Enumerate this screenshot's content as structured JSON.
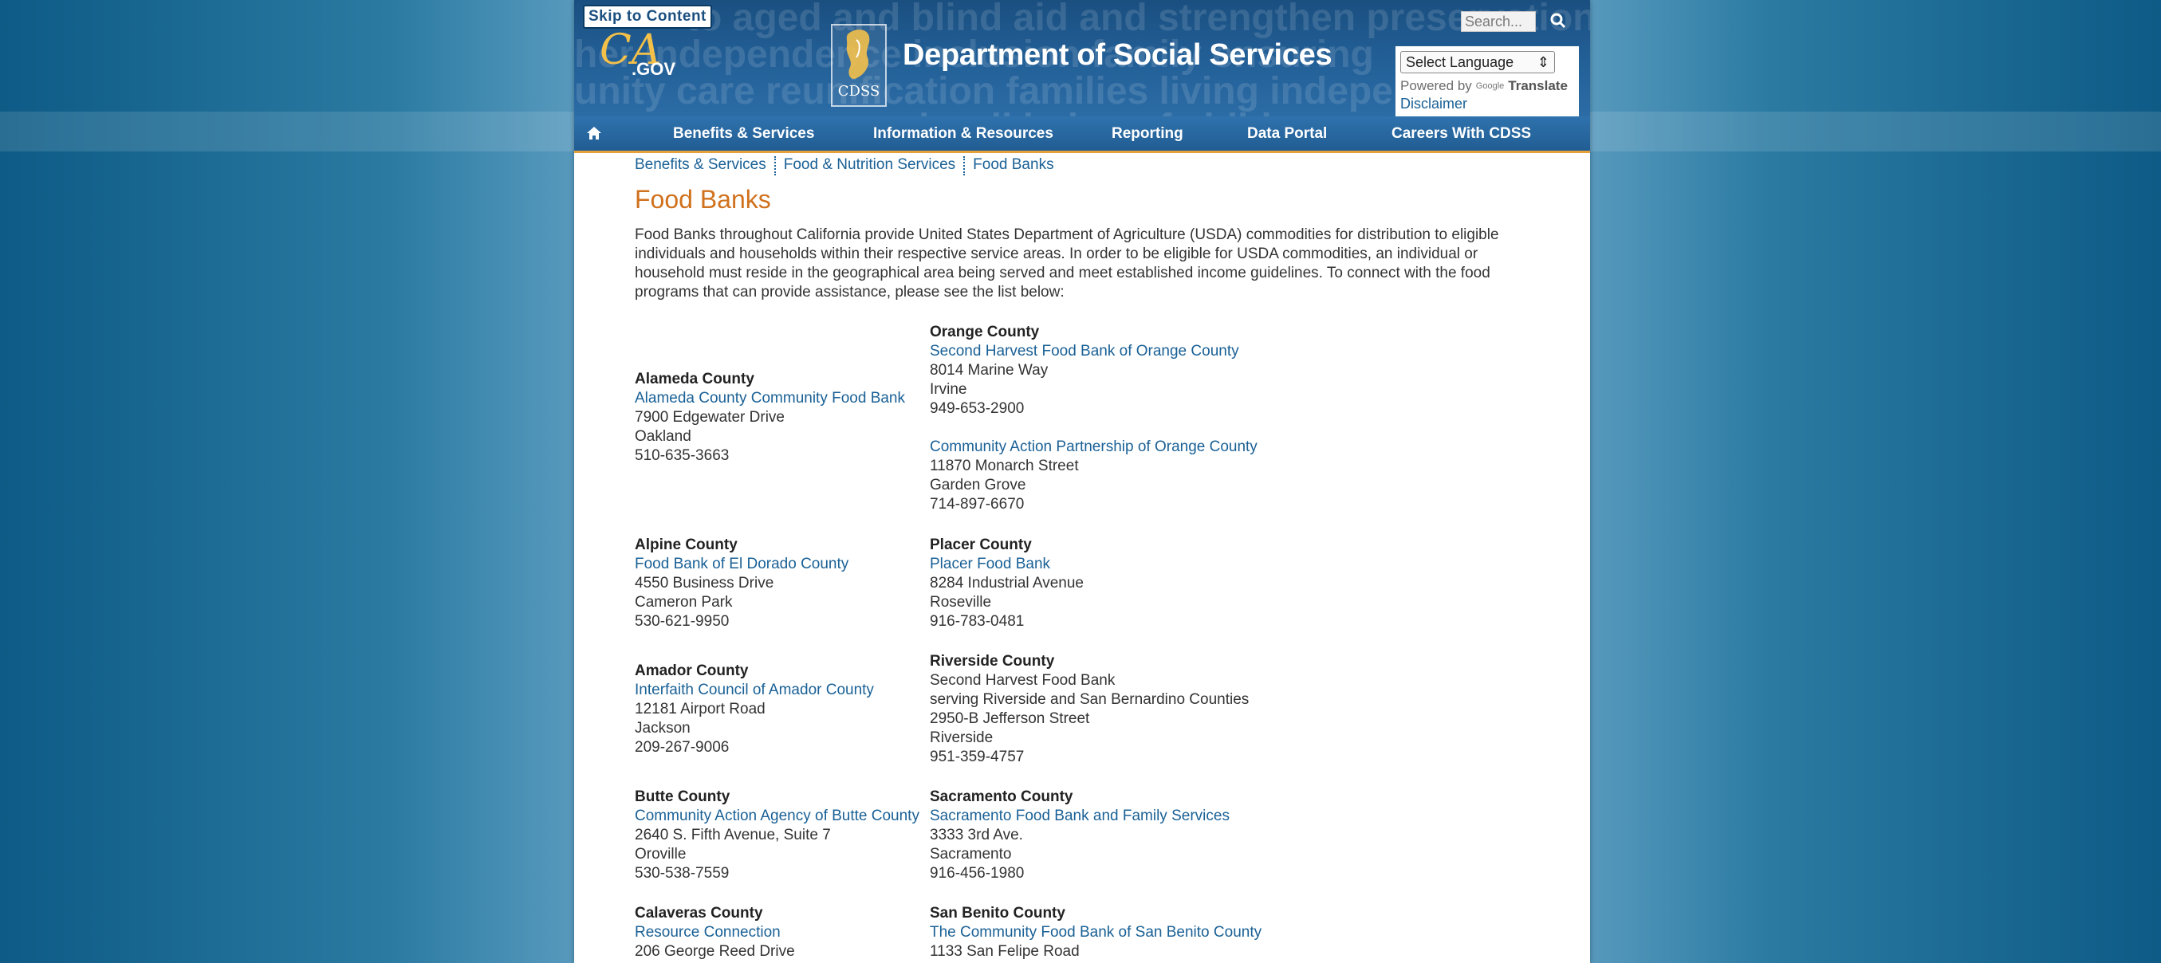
{
  "header": {
    "skip_link": "Skip to Content",
    "department_title": "Department of Social Services",
    "ca_logo_text": "CA.GOV",
    "cdss_logo_text": "CDSS",
    "search_placeholder": "Search...",
    "language_select": "Select Language",
    "powered_by": "Powered by",
    "google_text": "Google",
    "translate_text": "Translate",
    "disclaimer": "Disclaimer",
    "watermark_lines": [
      "to aged and blind aid and strengthen preservation",
      "her independence  inclusion  family  ensuring",
      "unity care reunification  families  living independently",
      "       and well being of children"
    ]
  },
  "nav": {
    "items": [
      "Benefits & Services",
      "Information & Resources",
      "Reporting",
      "Data Portal",
      "Careers With CDSS"
    ]
  },
  "breadcrumb": [
    "Benefits & Services",
    "Food & Nutrition Services",
    "Food Banks"
  ],
  "page_title": "Food Banks",
  "intro": "Food Banks throughout California provide United States Department of Agriculture (USDA) commodities for distribution to eligible individuals and households within their respective service areas. In order to be eligible for USDA commodities, an individual or household must reside in the geographical area being served and meet established income guidelines. To connect with the food programs that can provide assistance, please see the list below:",
  "left_column": [
    {
      "county": "Alameda County",
      "bank": "Alameda County Community Food Bank",
      "lines": [
        "7900 Edgewater Drive",
        "Oakland",
        "510-635-3663"
      ]
    },
    {
      "county": "Alpine County",
      "bank": "Food Bank of El Dorado County",
      "lines": [
        "4550 Business Drive",
        "Cameron Park",
        "530-621-9950"
      ]
    },
    {
      "county": "Amador County",
      "bank": "Interfaith Council of Amador County",
      "lines": [
        "12181 Airport Road",
        "Jackson",
        "209-267-9006"
      ]
    },
    {
      "county": "Butte County",
      "bank": "Community Action Agency of Butte County",
      "lines": [
        "2640 S. Fifth Avenue, Suite 7",
        "Oroville",
        "530-538-7559"
      ]
    },
    {
      "county": "Calaveras County",
      "bank": "Resource Connection",
      "lines": [
        "206 George Reed Drive"
      ]
    }
  ],
  "right_column": [
    {
      "county": "Orange County",
      "bank": "Second Harvest Food Bank of Orange County",
      "lines": [
        "8014 Marine Way",
        "Irvine",
        "949-653-2900"
      ]
    },
    {
      "county": "",
      "bank": "Community Action Partnership of Orange County",
      "lines": [
        "11870 Monarch Street",
        "Garden Grove",
        "714-897-6670"
      ]
    },
    {
      "county": "Placer County",
      "bank": "Placer Food Bank",
      "lines": [
        "8284 Industrial Avenue",
        "Roseville",
        "916-783-0481"
      ]
    },
    {
      "county": "Riverside County",
      "bank": "",
      "lines": [
        "Second Harvest Food Bank",
        "serving Riverside and San Bernardino Counties",
        "2950-B Jefferson Street",
        "Riverside",
        "951-359-4757"
      ]
    },
    {
      "county": "Sacramento County",
      "bank": "Sacramento Food Bank and Family Services",
      "lines": [
        "3333 3rd Ave.",
        "Sacramento",
        "916-456-1980"
      ]
    },
    {
      "county": "San Benito County",
      "bank": "The Community Food Bank of San Benito County",
      "lines": [
        "1133 San Felipe Road"
      ]
    }
  ]
}
